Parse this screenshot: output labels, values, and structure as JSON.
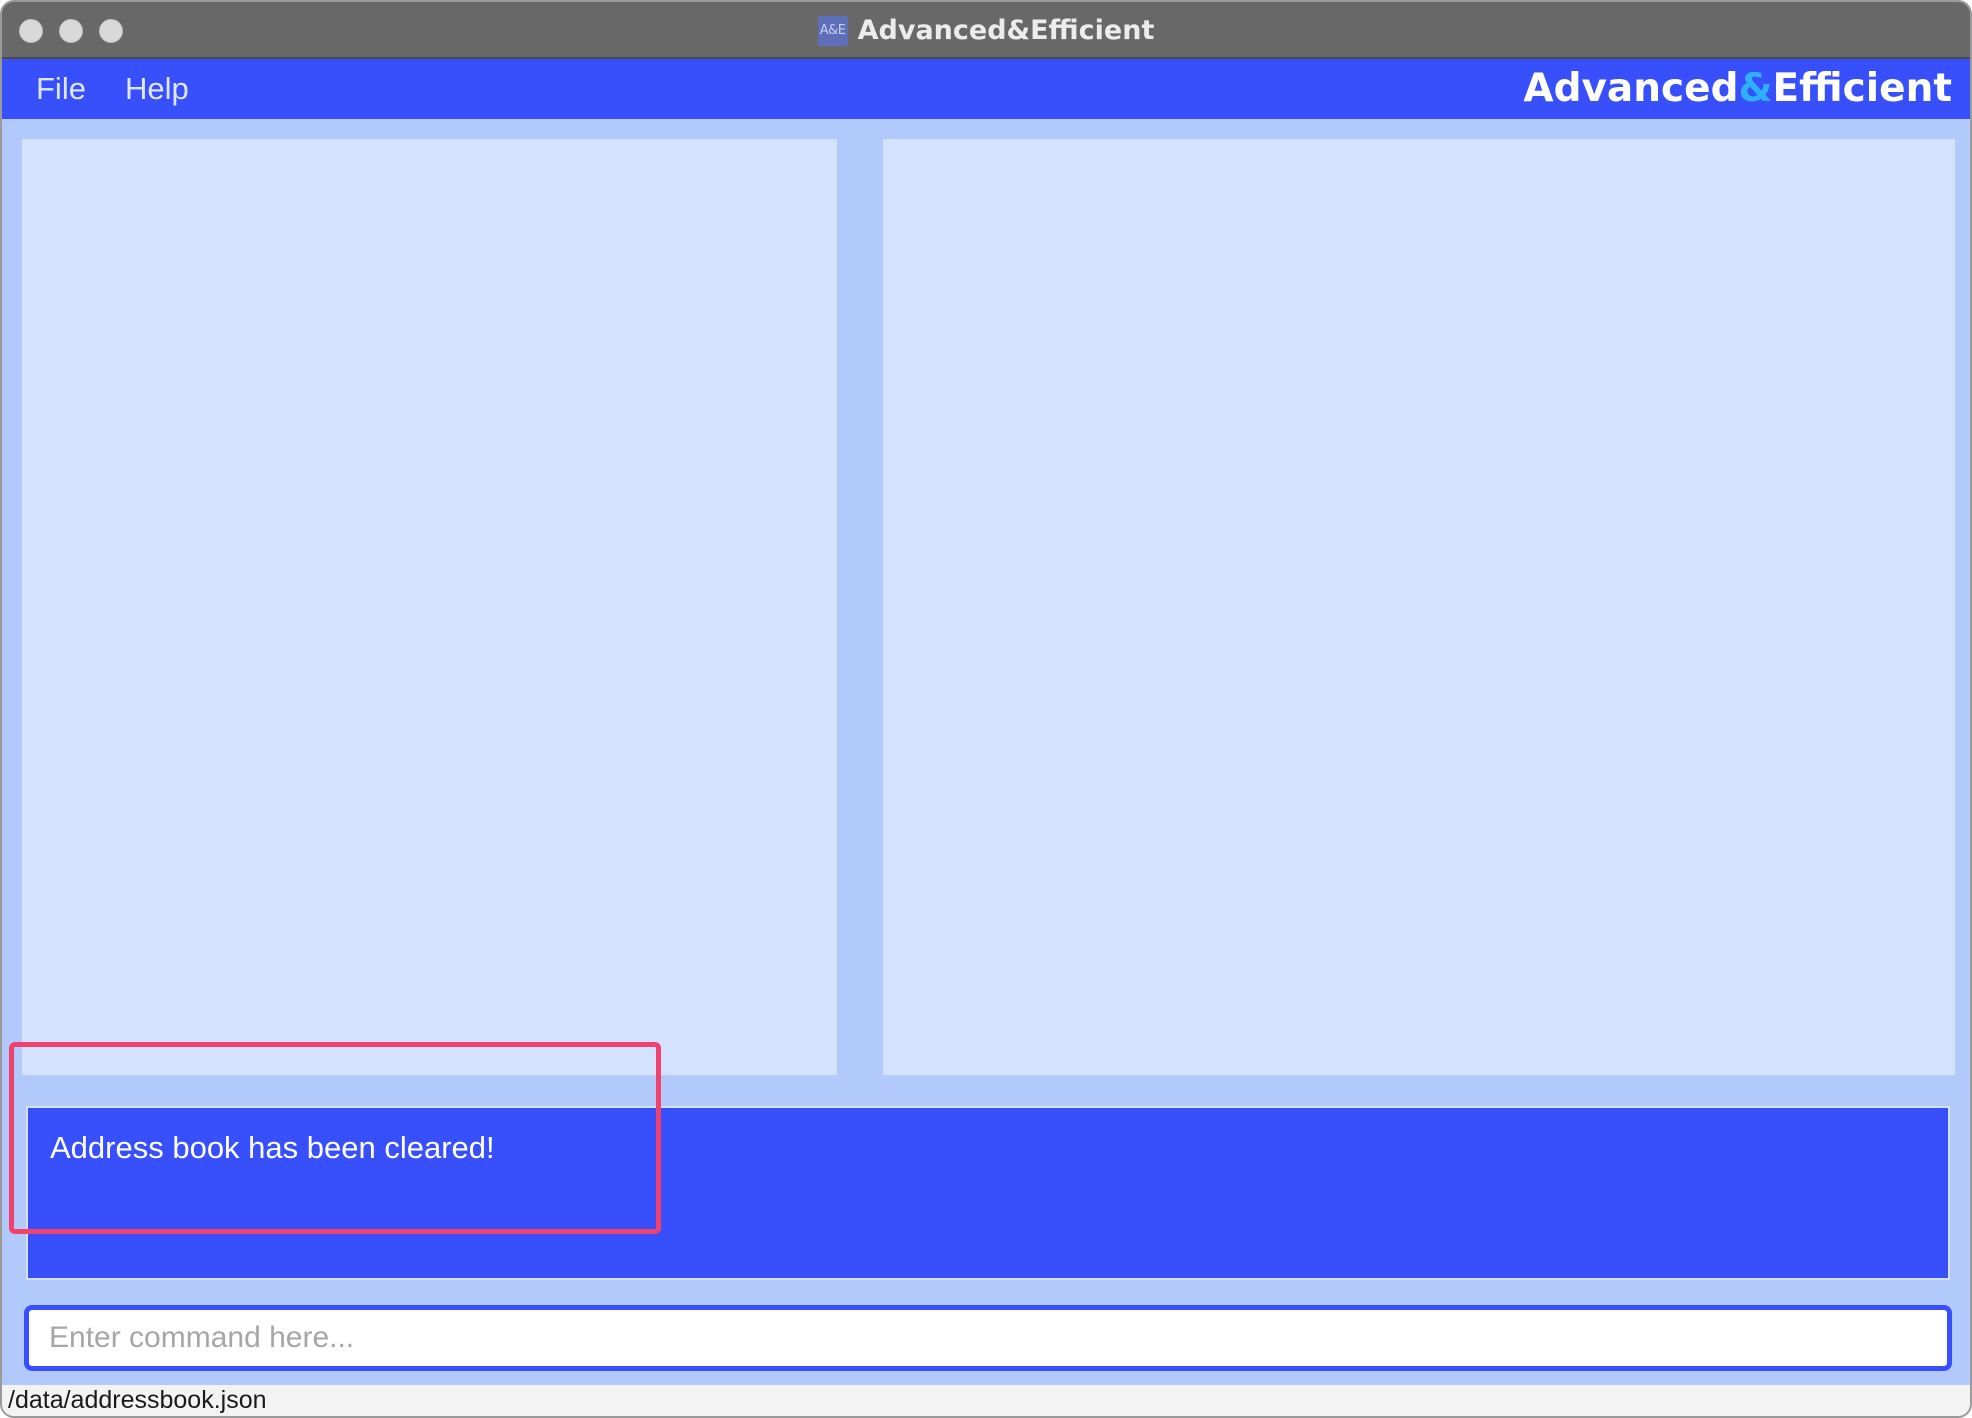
{
  "window": {
    "title": "Advanced&Efficient",
    "app_icon_text": "A&E"
  },
  "menu": {
    "items": [
      {
        "label": "File"
      },
      {
        "label": "Help"
      }
    ]
  },
  "brand": {
    "part1": "Advanced",
    "amp": "&",
    "part2": "Efficient"
  },
  "result": {
    "message": "Address book has been cleared!"
  },
  "command": {
    "placeholder": "Enter command here...",
    "value": ""
  },
  "status": {
    "file_path": "/data/addressbook.json"
  },
  "colors": {
    "accent": "#384ffc",
    "panel": "#d5e2fd",
    "background": "#b2c9fb",
    "highlight": "#f0426c",
    "brand_amp": "#2fb0ff"
  }
}
